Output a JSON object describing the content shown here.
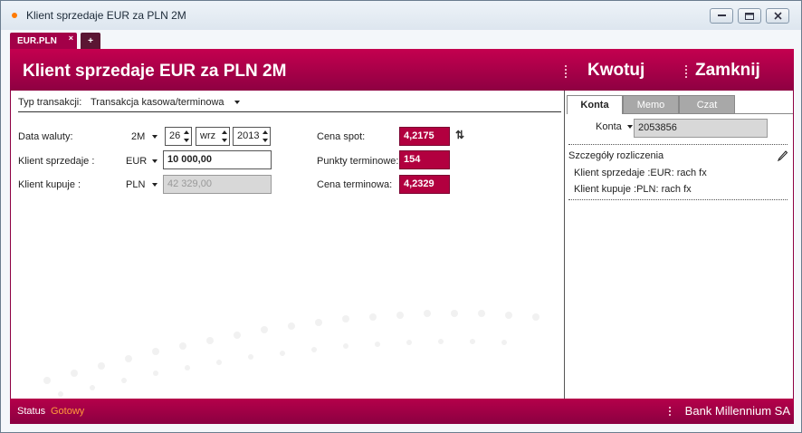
{
  "window": {
    "title": "Klient sprzedaje EUR za PLN 2M",
    "min_icon": "minimize-icon",
    "max_icon": "maximize-icon",
    "close_icon": "close-icon"
  },
  "tabs": [
    {
      "label": "EUR.PLN",
      "close": "×"
    },
    {
      "label": "+"
    }
  ],
  "header": {
    "title": "Klient sprzedaje EUR za PLN 2M",
    "quote_label": "Kwotuj",
    "close_label": "Zamknij"
  },
  "transaction": {
    "type_label": "Typ transakcji:",
    "type_value": "Transakcja kasowa/terminowa"
  },
  "form": {
    "value_date_label": "Data waluty:",
    "tenor": "2M",
    "day": "26",
    "month": "wrz",
    "year": "2013",
    "client_sells_label": "Klient sprzedaje :",
    "sell_currency": "EUR",
    "sell_amount": "10 000,00",
    "client_buys_label": "Klient kupuje :",
    "buy_currency": "PLN",
    "buy_amount": "42 329,00"
  },
  "prices": {
    "spot_label": "Cena spot:",
    "spot_value": "4,2175",
    "points_label": "Punkty terminowe:",
    "points_value": "154",
    "forward_label": "Cena terminowa:",
    "forward_value": "4,2329",
    "refresh_icon": "refresh-icon"
  },
  "right_panel": {
    "tabs": [
      "Konta",
      "Memo",
      "Czat"
    ],
    "account_label": "Konta",
    "account_value": "2053856",
    "settlement_title": "Szczegóły rozliczenia",
    "edit_icon": "pencil-icon",
    "settlement_lines": [
      "Klient sprzedaje :EUR: rach fx",
      "Klient kupuje :PLN: rach fx"
    ]
  },
  "status": {
    "label": "Status",
    "value": "Gotowy",
    "bank_name": "Bank Millennium SA"
  },
  "colors": {
    "brand": "#a30048",
    "status_value": "#ff9c3a"
  }
}
